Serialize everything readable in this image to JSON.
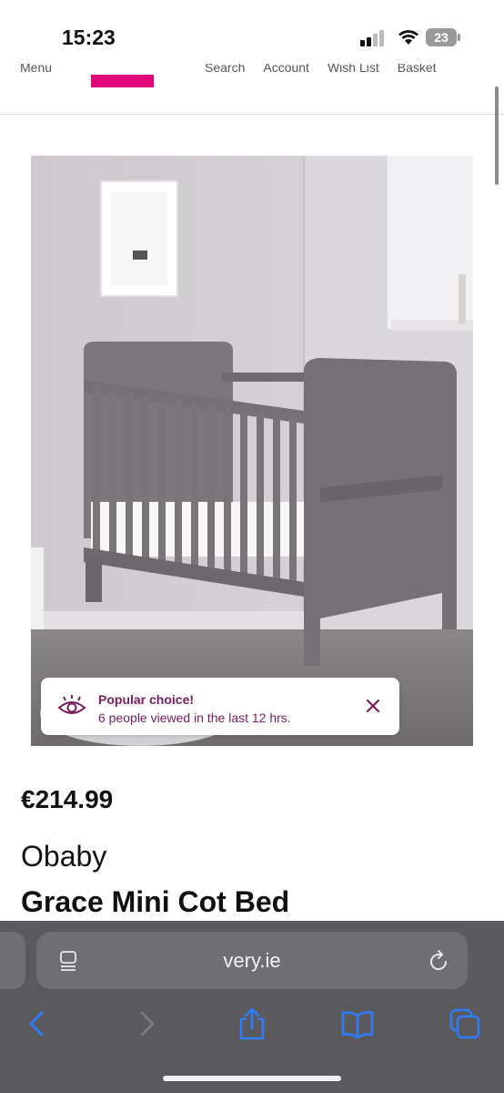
{
  "status_bar": {
    "time": "15:23",
    "battery": "23"
  },
  "header": {
    "menu_label": "Menu",
    "nav_links": [
      "Search",
      "Account",
      "Wish List",
      "Basket"
    ],
    "brand_color": "#e0077a"
  },
  "product": {
    "image_icon": "product-photo-grey-mini-cot-bed",
    "price": "€214.99",
    "brand": "Obaby",
    "title": "Grace Mini Cot Bed"
  },
  "toast": {
    "icon": "eye-icon",
    "title": "Popular choice!",
    "subtitle": "6 people viewed in the last 12 hrs.",
    "accent_color": "#7b1c5c"
  },
  "browser": {
    "url": "very.ie",
    "toolbar_icons": [
      "back-icon",
      "forward-icon",
      "share-icon",
      "bookmarks-icon",
      "tabs-icon"
    ],
    "accent_color": "#2f7cf6"
  }
}
